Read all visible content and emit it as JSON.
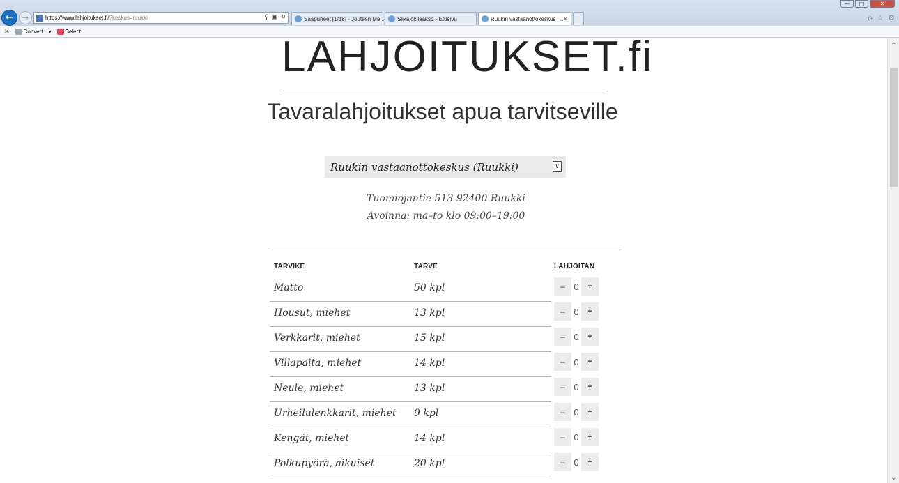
{
  "browser": {
    "address": {
      "host": "https://www.lahjoitukset.fi/",
      "path": "?keskus=ruukki"
    },
    "tabs": [
      {
        "label": "Saapuneet [1/18] - Joutsen Me..."
      },
      {
        "label": "Siikajokilaakso - Etusivu"
      },
      {
        "label": "Ruukin vastaanottokeskus | ...",
        "active": true
      }
    ],
    "commands": {
      "convert": "Convert",
      "select": "Select"
    }
  },
  "page": {
    "logo": "LAHJOITUKSET.fi",
    "tagline": "Tavaralahjoitukset apua tarvitseville",
    "center_select": "Ruukin vastaanottokeskus (Ruukki)",
    "address": "Tuomiojantie 513 92400 Ruukki",
    "hours": "Avoinna: ma–to klo 09:00–19:00",
    "table": {
      "headers": {
        "item": "TARVIKE",
        "need": "TARVE",
        "give": "LAHJOITAN"
      },
      "rows": [
        {
          "item": "Matto",
          "need": "50 kpl",
          "qty": "0"
        },
        {
          "item": "Housut, miehet",
          "need": "13 kpl",
          "qty": "0"
        },
        {
          "item": "Verkkarit, miehet",
          "need": "15 kpl",
          "qty": "0"
        },
        {
          "item": "Villapaita, miehet",
          "need": "14 kpl",
          "qty": "0"
        },
        {
          "item": "Neule, miehet",
          "need": "13 kpl",
          "qty": "0"
        },
        {
          "item": "Urheilulenkkarit, miehet",
          "need": "9 kpl",
          "qty": "0"
        },
        {
          "item": "Kengät, miehet",
          "need": "14 kpl",
          "qty": "0"
        },
        {
          "item": "Polkupyörä, aikuiset",
          "need": "20 kpl",
          "qty": "0"
        }
      ],
      "minus_label": "–",
      "plus_label": "+"
    }
  }
}
